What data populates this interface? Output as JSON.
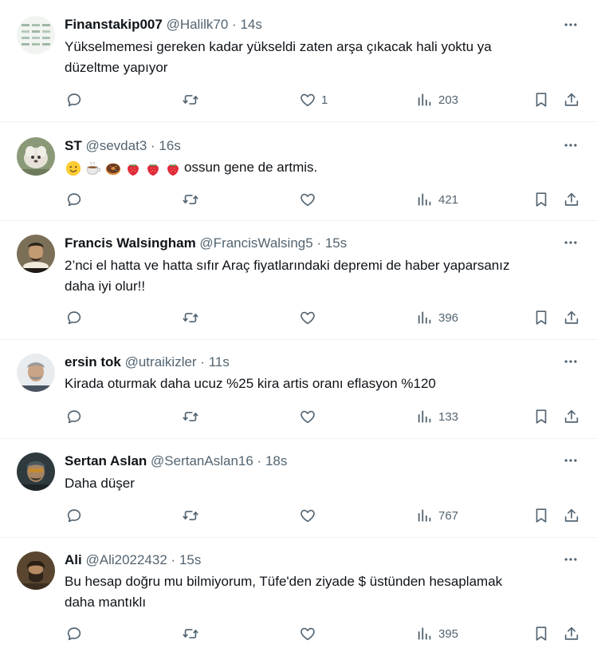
{
  "tweets": [
    {
      "name": "Finanstakip007",
      "handle": "@Halilk70",
      "time": "14s",
      "text_lines": [
        "Yükselmemesi gereken kadar yükseldi zaten arşa çıkacak hali yoktu ya",
        "düzeltme yapıyor"
      ],
      "replies": "",
      "retweets": "",
      "likes": "1",
      "views": "203"
    },
    {
      "name": "ST",
      "handle": "@sevdat3",
      "time": "16s",
      "text_lines": [
        "ossun gene de artmis."
      ],
      "emojis": [
        "slightly-smiling-face",
        "hot-beverage",
        "doughnut",
        "strawberry",
        "strawberry",
        "strawberry"
      ],
      "replies": "",
      "retweets": "",
      "likes": "",
      "views": "421"
    },
    {
      "name": "Francis Walsingham",
      "handle": "@FrancisWalsing5",
      "time": "15s",
      "text_lines": [
        "2’nci el hatta ve hatta sıfır Araç fiyatlarındaki depremi de haber yaparsanız",
        "daha iyi olur!!"
      ],
      "replies": "",
      "retweets": "",
      "likes": "",
      "views": "396"
    },
    {
      "name": "ersin tok",
      "handle": "@utraikizler",
      "time": "11s",
      "text_lines": [
        "Kirada oturmak daha ucuz %25 kira artis oranı eflasyon %120"
      ],
      "replies": "",
      "retweets": "",
      "likes": "",
      "views": "133"
    },
    {
      "name": "Sertan Aslan",
      "handle": "@SertanAslan16",
      "time": "18s",
      "text_lines": [
        "Daha düşer"
      ],
      "replies": "",
      "retweets": "",
      "likes": "",
      "views": "767"
    },
    {
      "name": "Ali",
      "handle": "@Ali2022432",
      "time": "15s",
      "text_lines": [
        "Bu hesap doğru mu bilmiyorum, Tüfe'den ziyade $ üstünden hesaplamak",
        "daha mantıklı"
      ],
      "replies": "",
      "retweets": "",
      "likes": "",
      "views": "395"
    }
  ],
  "ui": {
    "separator": "·",
    "icons": [
      "reply-icon",
      "retweet-icon",
      "like-icon",
      "views-icon",
      "bookmark-icon",
      "share-icon",
      "more-icon"
    ],
    "colors": {
      "text": "#0f1419",
      "secondary": "#536471",
      "border": "#eff3f4"
    }
  }
}
